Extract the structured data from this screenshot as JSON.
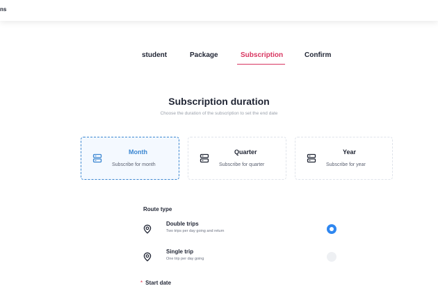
{
  "topbar": {
    "title_fragment": "ns"
  },
  "steps": {
    "items": [
      {
        "label": "student"
      },
      {
        "label": "Package"
      },
      {
        "label": "Subscription"
      },
      {
        "label": "Confirm"
      }
    ],
    "active_index": 2
  },
  "duration": {
    "title": "Subscription duration",
    "subtitle": "Choose the duration of the subscription to set the end date",
    "options": [
      {
        "title": "Month",
        "description": "Subscribe for month",
        "icon": "server-icon",
        "selected": true
      },
      {
        "title": "Quarter",
        "description": "Subscribe for quarter",
        "icon": "server-icon",
        "selected": false
      },
      {
        "title": "Year",
        "description": "Subscribe for year",
        "icon": "server-icon",
        "selected": false
      }
    ]
  },
  "route": {
    "label": "Route type",
    "options": [
      {
        "title": "Double trips",
        "description": "Two trips per day going and return",
        "icon": "location-pin-icon",
        "selected": true
      },
      {
        "title": "Single trip",
        "description": "One trip per day going",
        "icon": "location-pin-icon",
        "selected": false
      }
    ]
  },
  "start_date": {
    "required_mark": "*",
    "label": "Start date"
  },
  "colors": {
    "accent_pink": "#d8345f",
    "accent_blue": "#3a86d1",
    "radio_blue": "#2f87f0",
    "required_red": "#e0334f"
  }
}
